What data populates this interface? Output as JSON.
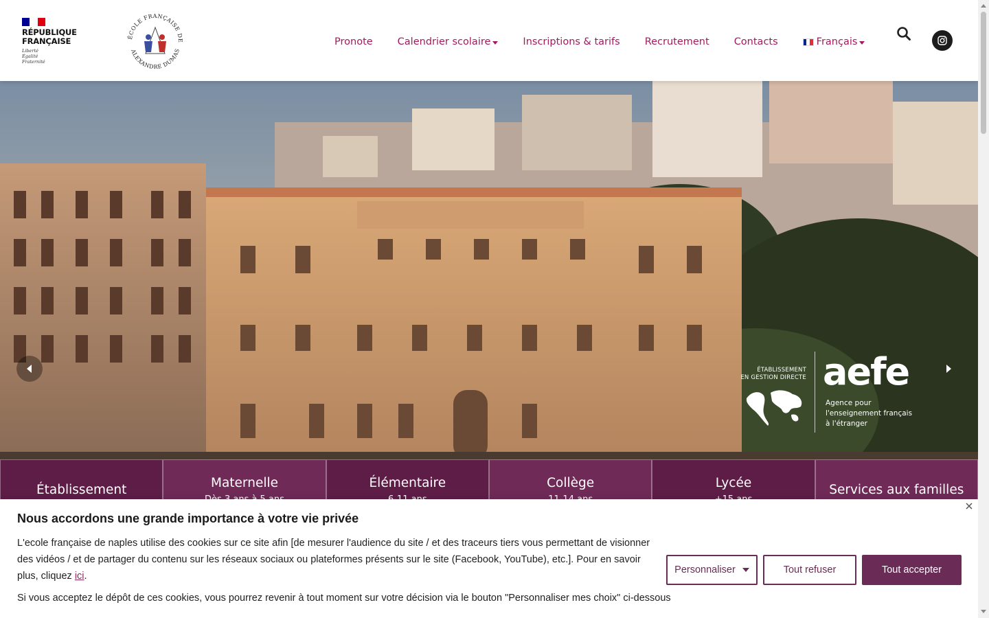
{
  "header": {
    "rf_title": "RÉPUBLIQUE\nFRANÇAISE",
    "rf_motto": "Liberté\nÉgalité\nFraternité",
    "school_logo_text_top": "ÉCOLE FRANÇAISE DE NAPLES",
    "school_logo_text_bottom": "ALEXANDRE DUMAS"
  },
  "nav": {
    "items": [
      {
        "label": "Pronote",
        "has_dropdown": false
      },
      {
        "label": "Calendrier scolaire",
        "has_dropdown": true
      },
      {
        "label": "Inscriptions & tarifs",
        "has_dropdown": false
      },
      {
        "label": "Recrutement",
        "has_dropdown": false
      },
      {
        "label": "Contacts",
        "has_dropdown": false
      }
    ],
    "language": "Français",
    "search_icon": "search-icon",
    "social_icon": "instagram-icon"
  },
  "hero": {
    "aefe_sub": "ÉTABLISSEMENT\nEN GESTION DIRECTE",
    "aefe_name": "aefe",
    "aefe_tag": "Agence pour\nl'enseignement français\nà l'étranger",
    "prev_icon": "chevron-left-icon",
    "next_icon": "chevron-right-icon"
  },
  "tiles": [
    {
      "title": "Établissement",
      "subtitle": ""
    },
    {
      "title": "Maternelle",
      "subtitle": "Dès 3 ans à 5 ans"
    },
    {
      "title": "Élémentaire",
      "subtitle": "6-11 ans"
    },
    {
      "title": "Collège",
      "subtitle": "11-14 ans"
    },
    {
      "title": "Lycée",
      "subtitle": "+15 ans"
    },
    {
      "title": "Services aux familles",
      "subtitle": ""
    }
  ],
  "colors": {
    "brand": "#a31a5f",
    "tile_dark": "#5e1d47",
    "tile_light": "#6f2a57",
    "button": "#6b2b57"
  },
  "cookie": {
    "title": "Nous accordons une grande importance à votre vie privée",
    "text_before_link": "L'ecole française de naples utilise des cookies sur ce site afin [de mesurer l'audience du site / et des traceurs tiers vous permettant de visionner des vidéos / et de partager du contenu sur les réseaux sociaux ou plateformes présents sur le site (Facebook, YouTube), etc.]. Pour en savoir plus, cliquez ",
    "link": "ici",
    "text_after_link": ".",
    "text2": "Si vous acceptez le dépôt de ces cookies, vous pourrez revenir à tout moment sur votre décision via le bouton \"Personnaliser mes choix\" ci-dessous",
    "btn_customize": "Personnaliser",
    "btn_refuse": "Tout refuser",
    "btn_accept": "Tout accepter"
  }
}
